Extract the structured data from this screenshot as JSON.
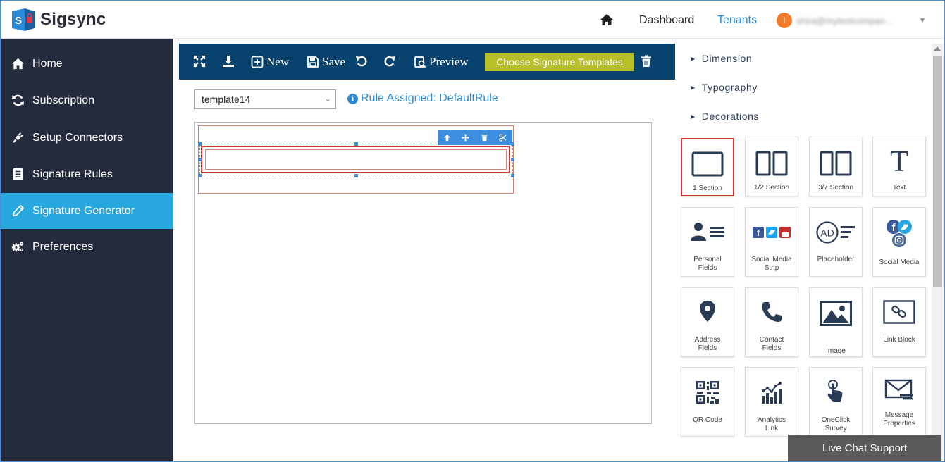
{
  "app": {
    "name": "Sigsync"
  },
  "header": {
    "dashboard": "Dashboard",
    "tenants": "Tenants",
    "user_initial": "I",
    "user_email": "shira@mytestcompan..."
  },
  "sidebar": {
    "items": [
      {
        "label": "Home",
        "icon": "home-icon"
      },
      {
        "label": "Subscription",
        "icon": "refresh-icon"
      },
      {
        "label": "Setup Connectors",
        "icon": "plug-icon"
      },
      {
        "label": "Signature Rules",
        "icon": "list-icon"
      },
      {
        "label": "Signature Generator",
        "icon": "pencil-icon",
        "active": true
      },
      {
        "label": "Preferences",
        "icon": "gears-icon"
      }
    ]
  },
  "toolbar": {
    "new_label": "New",
    "save_label": "Save",
    "preview_label": "Preview",
    "choose_templates": "Choose Signature Templates"
  },
  "template": {
    "selected": "template14",
    "rule_assigned": "Rule Assigned: DefaultRule"
  },
  "panel": {
    "sections": [
      "Dimension",
      "Typography",
      "Decorations"
    ],
    "tiles": [
      {
        "label": "1 Section",
        "icon": "one-section-icon"
      },
      {
        "label": "1/2 Section",
        "icon": "half-section-icon"
      },
      {
        "label": "3/7 Section",
        "icon": "three-seven-section-icon"
      },
      {
        "label": "Text",
        "icon": "text-icon"
      },
      {
        "label": "Personal Fields",
        "icon": "personal-fields-icon"
      },
      {
        "label": "Social Media Strip",
        "icon": "social-strip-icon"
      },
      {
        "label": "Placeholder",
        "icon": "placeholder-icon"
      },
      {
        "label": "Social Media",
        "icon": "social-media-icon"
      },
      {
        "label": "Address Fields",
        "icon": "map-pin-icon"
      },
      {
        "label": "Contact Fields",
        "icon": "phone-icon"
      },
      {
        "label": "Image",
        "icon": "image-icon"
      },
      {
        "label": "Link Block",
        "icon": "link-icon"
      },
      {
        "label": "QR Code",
        "icon": "qr-code-icon"
      },
      {
        "label": "Analytics Link",
        "icon": "analytics-icon"
      },
      {
        "label": "OneClick Survey",
        "icon": "tap-icon"
      },
      {
        "label": "Message Properties",
        "icon": "envelope-icon"
      }
    ]
  },
  "chat": {
    "label": "Live Chat Support"
  },
  "colors": {
    "sidebar_bg": "#242b3d",
    "sidebar_active": "#29a8e0",
    "toolbar_bg": "#08426e",
    "choose_btn": "#b7c027",
    "link_blue": "#2b8bd6",
    "icon_dark": "#2a3b55",
    "selection_red": "#d43333"
  }
}
